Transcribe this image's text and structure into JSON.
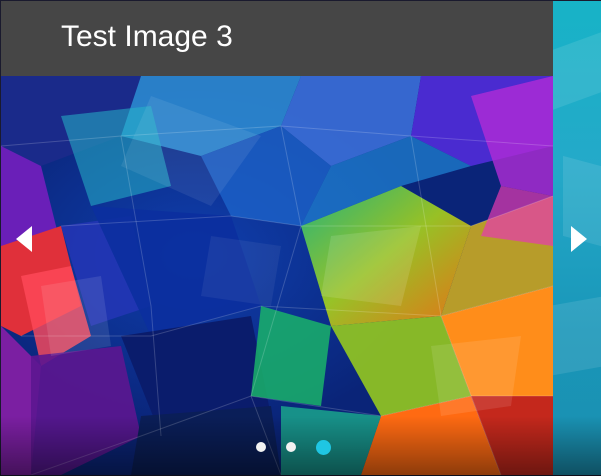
{
  "carousel": {
    "caption": "Test Image 3",
    "prev_icon": "chevron-left-icon",
    "next_icon": "chevron-right-icon",
    "dots_total": 3,
    "active_dot": 3,
    "colors": {
      "caption_bar": "#464646",
      "active_dot": "#1fc6e3",
      "inactive_dot": "#f2f2f2",
      "next_slide_peek": "#17b3c7"
    }
  }
}
